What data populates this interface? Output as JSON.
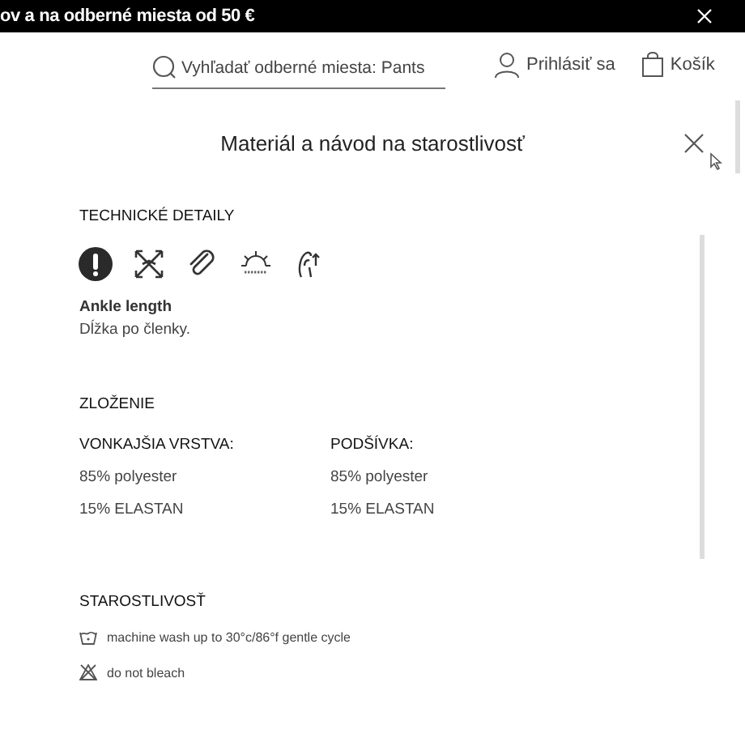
{
  "promo_bar": {
    "text": "ov a na odberné miesta od 50 €"
  },
  "header": {
    "search": {
      "placeholder": "Vyhľadať odberné miesta: Pants"
    },
    "login": "Prihlásiť sa",
    "cart": "Košík"
  },
  "modal": {
    "title": "Materiál a návod na starostlivosť",
    "technical": {
      "heading": "TECHNICKÉ DETAILY",
      "icons": [
        {
          "kind": "info"
        },
        {
          "kind": "stretch"
        },
        {
          "kind": "clip"
        },
        {
          "kind": "upf"
        },
        {
          "kind": "hand"
        }
      ],
      "feature_title": "Ankle length",
      "feature_text": "Dĺžka po členky."
    },
    "composition": {
      "heading": "ZLOŽENIE",
      "columns": [
        {
          "title": "VONKAJŠIA VRSTVA:",
          "items": [
            "85% polyester",
            "15% ELASTAN"
          ]
        },
        {
          "title": "PODŠÍVKA:",
          "items": [
            "85% polyester",
            "15% ELASTAN"
          ]
        }
      ]
    },
    "care": {
      "heading": "STAROSTLIVOSŤ",
      "items": [
        {
          "kind": "wash",
          "text": "machine wash up to 30°c/86°f gentle cycle"
        },
        {
          "kind": "no-bleach",
          "text": "do not bleach"
        }
      ]
    }
  }
}
